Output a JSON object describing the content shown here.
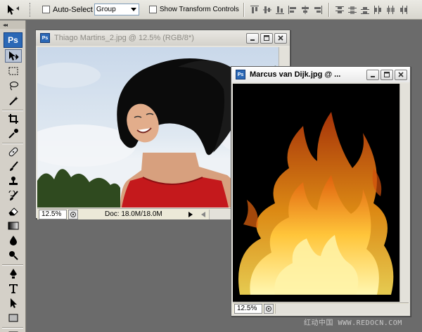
{
  "options_bar": {
    "auto_select_label": "Auto-Select",
    "auto_select_value": "Group",
    "show_transform_label": "Show Transform Controls"
  },
  "toolbox": {
    "logo_text": "Ps",
    "tools": [
      "move-tool",
      "marquee-tool",
      "lasso-tool",
      "magic-wand-tool",
      "crop-tool",
      "eyedropper-tool",
      "healing-brush-tool",
      "brush-tool",
      "clone-stamp-tool",
      "history-brush-tool",
      "eraser-tool",
      "gradient-tool",
      "blur-tool",
      "dodge-tool",
      "pen-tool",
      "type-tool",
      "path-selection-tool",
      "rectangle-tool",
      "notes-tool"
    ]
  },
  "windows": [
    {
      "title": "Thiago Martins_2.jpg @ 12.5% (RGB/8*)",
      "zoom": "12.5%",
      "doc_info": "Doc: 18.0M/18.0M",
      "active": false
    },
    {
      "title": "Marcus van Dijk.jpg @ ...",
      "zoom": "12.5%",
      "active": true
    }
  ],
  "watermark": "红动中国 WWW.REDOCN.COM",
  "colors": {
    "workspace": "#6b6b6b",
    "panel": "#d4d0c8",
    "ps_blue": "#2b68b6",
    "dress_red": "#c4191c",
    "flame_orange": "#f08a12"
  }
}
